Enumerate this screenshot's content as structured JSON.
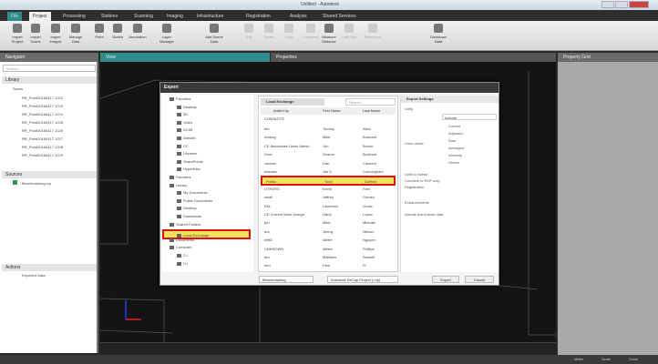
{
  "window": {
    "title": "Untitled - Autodesk"
  },
  "ribbon_tabs": [
    "File",
    "Project",
    "Processing",
    "Stations",
    "Scanning",
    "Imaging",
    "Infrastructure",
    "Registration",
    "Analysis",
    "Shared Services"
  ],
  "ribbon_buttons": [
    "Import Project",
    "Import Scans",
    "Import Images",
    "Manage Data",
    "Point",
    "Sketch",
    "Annotation",
    "Layer Manager",
    "Add Scene Data",
    "Edit",
    "Delete",
    "Unify",
    "Segment",
    "Measure Distance",
    "Limit Box",
    "Reference",
    "Download Data"
  ],
  "panes": {
    "left": "Navigator",
    "view": "View",
    "properties": "Properties",
    "right": "Property Grid"
  },
  "left": {
    "search_placeholder": "Search",
    "library": "Library",
    "root": "Scans",
    "scans": [
      "RR_Point20160417 1/1/2",
      "RR_Point20160417 1/2/3",
      "RR_Point20160417 1/2/4",
      "RR_Point20160417 1/2/5",
      "RR_Point20160417 1/2/6",
      "RR_Point20160417 1/2/7",
      "RR_Point20160417 1/2/8",
      "RR_Point20160417 1/2/9"
    ],
    "sources": "Sources",
    "source_item": "Benchmarking.rcp",
    "actions": "Actions",
    "action_item": "Exported Data"
  },
  "dialog": {
    "title": "Export",
    "tree": [
      "Favorites",
      "Desktop",
      "3D",
      "Video",
      "DCIM",
      "Artwork",
      "CC",
      "Libraries",
      "SharePoints",
      "Hyperlinks",
      "Favorites",
      "Library",
      "My Documents",
      "Public Documents",
      "Desktop",
      "Downloads",
      "Shared Folders",
      "Local Exchange",
      "Documents",
      "Computer",
      "C:\\",
      "D:\\"
    ],
    "list_tab": "Local Exchange",
    "search_placeholder": "Search",
    "columns": [
      "Added by",
      "First Name",
      "Last Name"
    ],
    "group": "CONTACTS",
    "rows": [
      [
        "bm",
        "Tommy",
        "Allen"
      ],
      [
        "Ambag",
        "Mike",
        "Brainard"
      ],
      [
        "CE Associates Users Admin",
        "Jon",
        "Brown"
      ],
      [
        "Dont",
        "Sharon",
        "Burkhart"
      ],
      [
        "vadmin",
        "Dan",
        "Clement"
      ],
      [
        "testuser",
        "Jim D",
        "Cunningham"
      ],
      [
        "Public",
        "Todd",
        "Duffield"
      ],
      [
        "OTHERS",
        "Kevin",
        "Fam"
      ],
      [
        "swall",
        "Jeffrey",
        "Gomez"
      ],
      [
        "Ells",
        "Lawrence",
        "Gross"
      ],
      [
        "CE Current Work Design",
        "Harry",
        "Lopez"
      ],
      [
        "fpu",
        "Mike",
        "Michael"
      ],
      [
        "urs",
        "Jimmy",
        "Nelson"
      ],
      [
        "bett2",
        "Albert",
        "Nguyen"
      ],
      [
        "UNKNOWN",
        "Alfred",
        "Phillips"
      ],
      [
        "dru",
        "Matthew",
        "Russell"
      ],
      [
        "mm",
        "Paul",
        "Pi"
      ]
    ],
    "highlight_row": 6,
    "filename": "Benchmarking",
    "format": "Autodesk ReCap Project (.rcp)",
    "settings": {
      "title": "Export Settings",
      "labels": [
        "Unify",
        "Color mode",
        "Limit to Scene",
        "Combine to RCP only",
        "Registration",
        "Enhancements",
        "Include point cloud data"
      ],
      "dropdown": "Include",
      "options": [
        "Current",
        "Adjusted",
        "Raw",
        "Averaged",
        "Intensity",
        "Others"
      ]
    },
    "buttons": {
      "export": "Export",
      "cancel": "Cancel"
    }
  },
  "status": {
    "items": [
      "Meter",
      "Scale",
      "Zoom"
    ]
  }
}
